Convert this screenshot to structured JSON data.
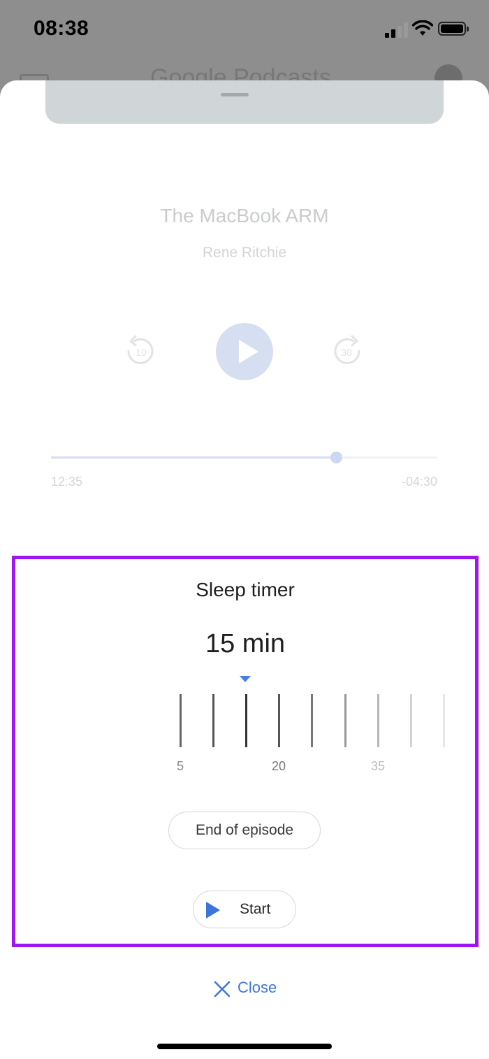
{
  "status": {
    "time": "08:38"
  },
  "background": {
    "title": "Google Podcasts"
  },
  "episode": {
    "title": "The MacBook ARM",
    "author": "Rene Ritchie",
    "rewind_seconds": "10",
    "forward_seconds": "30"
  },
  "progress": {
    "elapsed": "12:35",
    "remaining": "-04:30",
    "fraction": 0.737
  },
  "timer": {
    "title": "Sleep timer",
    "value": "15 min",
    "scale_labels": [
      "5",
      "20",
      "35"
    ],
    "end_of_episode_label": "End of episode",
    "start_label": "Start"
  },
  "close_label": "Close",
  "colors": {
    "accent": "#3c74de",
    "highlight_border": "#9f17f0"
  }
}
